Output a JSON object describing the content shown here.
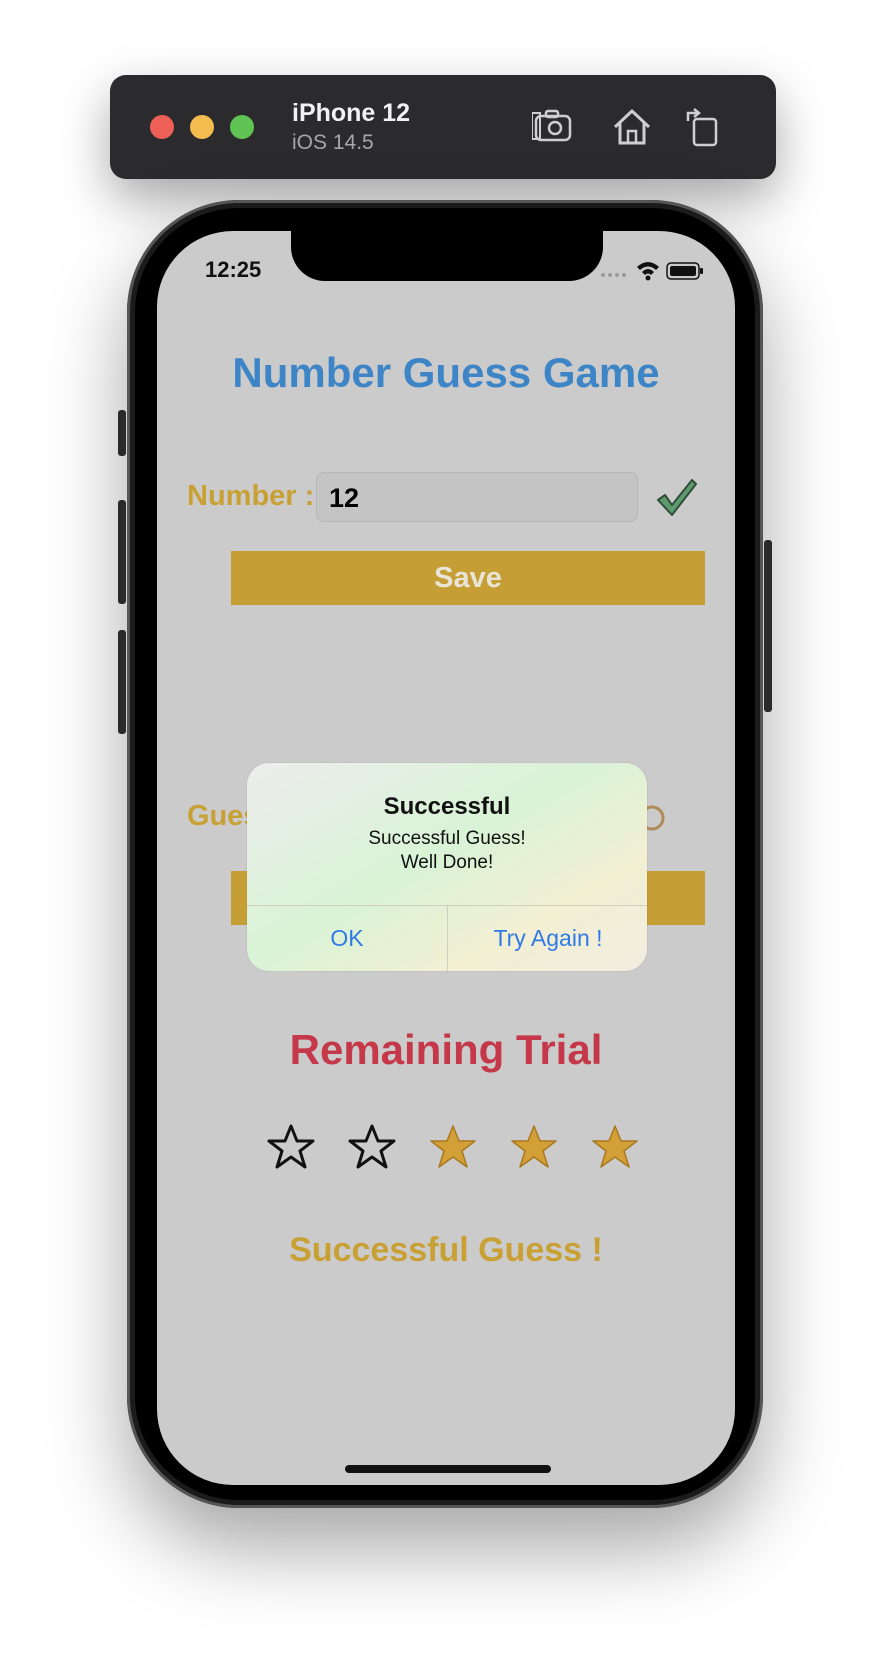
{
  "simulator": {
    "device_name": "iPhone 12",
    "os_version": "iOS 14.5",
    "controls": [
      "screenshot-icon",
      "home-icon",
      "rotate-icon"
    ]
  },
  "status_bar": {
    "time": "12:25"
  },
  "app": {
    "title": "Number Guess Game",
    "number_label": "Number :",
    "number_value": "12",
    "save_label": "Save",
    "guess_label_partial": "Gues",
    "remaining_title": "Remaining Trial",
    "stars": {
      "total": 5,
      "filled": 3
    },
    "result_text": "Successful Guess !"
  },
  "alert": {
    "title": "Successful",
    "message_line1": "Successful Guess!",
    "message_line2": "Well Done!",
    "ok_label": "OK",
    "try_again_label": "Try Again !"
  },
  "colors": {
    "title_blue": "#3d85c6",
    "gold": "#c59f35",
    "remaining_red": "#c5384a",
    "alert_button_blue": "#2f7ae5"
  }
}
